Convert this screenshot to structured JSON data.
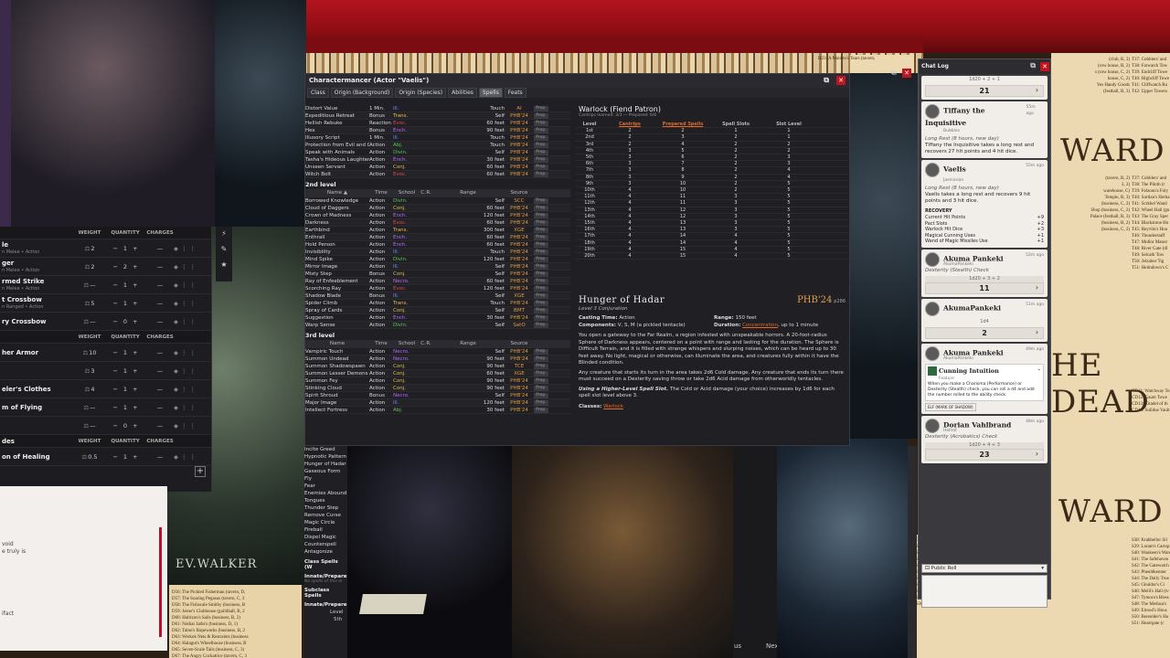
{
  "map": {
    "heading_ward_1": "WARD",
    "heading_dead": "HE DEAD",
    "heading_ward_2": "WARD",
    "right_list_top": [
      "T37: Cobblers' and",
      "T38: Farwatch Tow",
      "T39: Endcliff Towe",
      "T40: Highcliff Towe",
      "T41: Cliffwatch Ru",
      "T42: Upper Towers"
    ],
    "right_list_mid": [
      "T37: Cobblers' and",
      "T38: The Plinth (r",
      "T39: Felzoun's Foly",
      "T40: Surtlan's Herbal",
      "T41: Scrkhel Wand",
      "T42: Wheel Hall (gu",
      "T43: The Gray Sper",
      "T44: Blackstone Ho",
      "T45: Reyvlin's Hou",
      "T46: Thunderstaff",
      "T47: Mullor Manor",
      "T48: River Gate (dl",
      "T49: Selcath Tow",
      "T50: Jelzabor Tig",
      "T51: Helmdown's C"
    ],
    "right_list_mid_left": [
      "(tavern, B, 2)",
      "3, 2)",
      "warehouse, C)",
      "Temple, B, 3)",
      "(business, C, 2)",
      "Shop (business, C, 2)",
      "Palace (festhall, B, 3)",
      "(business, B, 2)",
      "(business, C, 2)"
    ],
    "right_list_low": [
      "CD11: Watchway To",
      "CD12: Gaunt Towe",
      "CD13: Citadel of th",
      "CD14: Sulldue Vault"
    ],
    "right_list_bottom": [
      "S38: Krabbellor Sil",
      "S39: Luram's Cartop",
      "S40: Waukeen's Ware",
      "S41: The Safehaven",
      "S42: The Gatewatch",
      "S43: Pheuldkenner",
      "S44: The Daily True",
      "S45: Ghuldor's Ci",
      "S46: Melil's Hall (tv",
      "S47: Tymora's Bless",
      "S48: The Medusa's",
      "S49: Elrood's Hous",
      "S50: Berenlder's Ha",
      "S51: Hoarrgate (c"
    ],
    "bottom_center_list": [
      "Inn (tavern, B, 3)",
      "S27: Wheelwright's (business, B, 3)",
      "S28: Tobold's (inn house, B)",
      "S29: Gauntlet Hall (rooming house, B, 4)",
      "S30: Irnsolm's Hall (store, B)",
      "S31: Patrician's Curios (business, C)",
      "S32: Ashmit's Laundry (business, C, 1)",
      "S33: Rakhem Inggen's residence (row house, B, 3)",
      "S34: Helmgrarns's Tables (business, B, 3)",
      "S35: Twelve Tors (business, C)",
      "S36: Kelsh Wagonjewls (business, B, 2)"
    ],
    "bottom_mid_list": [
      "Mordan Garzh's Boarding House",
      "Heart's Cheers (festhall, C)"
    ],
    "bottom_left_list": [
      "D56: The Pickled Fisherman (tavern, D,",
      "D57: The Soaring Pegasus (tavern, C, 3",
      "D58: The Fishscale Smithy (business, B",
      "D59: Jester's Clubhouse (guildhall, B, 2",
      "D60: Halrizon's Sails (business, B, 2)",
      "D61: Nothar Jaths's (business, D, 1)",
      "D62: Talnu's Ropeworks (business, B, 2",
      "D63: Werkok Nets & Restraints (business",
      "D64: Halagut's Wheelhouse (business, B",
      "D65: Seven-Scale Tails (business, C, 3)",
      "D67: The Angry Cockatrice (tavern, C, 3"
    ],
    "chunk_h": "H23: A Maiden's Tears (tavern,",
    "chunk_h2": "H28: The Bad Tavern (tavern, B,",
    "chunk_h3": "H29: Wolfgard's (business, B, 2)",
    "chunk_h4": "H30: The Manor Retreat (tavern, C, 2)",
    "chunk_right_top": [
      "(club, B, 3)",
      "(row house, B, 2)",
      "s (row house, C, 2)",
      "house, C, 2)",
      "Yes Handy Goods",
      "(festhall, B, 3)"
    ],
    "ev_walker": "EV.WALKER",
    "bottom_tab_us": "us",
    "bottom_tab_nex": "Nex"
  },
  "inventory": {
    "headers": {
      "weight": "WEIGHT",
      "quantity": "QUANTITY",
      "charges": "CHARGES"
    },
    "items": [
      {
        "name": "le",
        "sub": "n Melee • Action",
        "weight": "2",
        "qty": "1",
        "charges": "—"
      },
      {
        "name": "ger",
        "sub": "n Melee • Action",
        "weight": "2",
        "qty": "2",
        "charges": "—"
      },
      {
        "name": "rmed Strike",
        "sub": "n Melee • Action",
        "weight": "—",
        "qty": "1",
        "charges": "—"
      },
      {
        "name": "t Crossbow",
        "sub": "n Ranged • Action",
        "weight": "5",
        "qty": "1",
        "charges": "—"
      },
      {
        "name": "ry Crossbow",
        "sub": "",
        "weight": "—",
        "qty": "0",
        "charges": "—"
      }
    ],
    "armor_headers": {
      "weight": "WEIGHT",
      "quantity": "QUANTITY",
      "charges": "CHARGES"
    },
    "armor_items": [
      {
        "name": "her Armor",
        "sub": "",
        "weight": "10",
        "qty": "1",
        "charges": "—"
      },
      {
        "name": "",
        "sub": "",
        "weight": "3",
        "qty": "1",
        "charges": "—"
      },
      {
        "name": "eler's Clothes",
        "sub": "",
        "weight": "4",
        "qty": "1",
        "charges": "—"
      },
      {
        "name": "m of Flying",
        "sub": "",
        "weight": "—",
        "qty": "1",
        "charges": "—"
      },
      {
        "name": "",
        "sub": "",
        "weight": "—",
        "qty": "0",
        "charges": "—"
      }
    ],
    "consumables_label": "des",
    "consumables_headers": {
      "weight": "WEIGHT",
      "quantity": "QUANTITY",
      "charges": "CHARGES"
    },
    "consumables_items": [
      {
        "name": "on of Healing",
        "sub": "",
        "weight": "0.5",
        "qty": "1",
        "charges": "—"
      }
    ]
  },
  "notes": {
    "lines": [
      "void",
      "e truly is",
      "ifact"
    ]
  },
  "charactermancer": {
    "title": "Charactermancer (Actor \"Vaelis\")",
    "tabs": [
      "Class",
      "Origin (Background)",
      "Origin (Species)",
      "Abilities",
      "Spells",
      "Feats"
    ],
    "level1_rows": [
      [
        "Distort Value",
        "1 Min.",
        "Ill.",
        "Touch",
        "AI"
      ],
      [
        "Expeditious Retreat",
        "Bonus",
        "Trans.",
        "Self",
        "PHB'24"
      ],
      [
        "Hellish Rebuke",
        "Reaction",
        "Evoc.",
        "60 feet",
        "PHB'24"
      ],
      [
        "Hex",
        "Bonus",
        "Ench.",
        "90 feet",
        "PHB'24"
      ],
      [
        "Illusory Script",
        "1 Min.",
        "Ill.",
        "Touch",
        "PHB'24"
      ],
      [
        "Protection from Evil and Good",
        "Action",
        "Abj.",
        "Touch",
        "PHB'24"
      ],
      [
        "Speak with Animals",
        "Action",
        "Divin.",
        "Self",
        "PHB'24"
      ],
      [
        "Tasha's Hideous Laughter",
        "Action",
        "Ench.",
        "30 feet",
        "PHB'24"
      ],
      [
        "Unseen Servant",
        "Action",
        "Conj.",
        "60 feet",
        "PHB'24"
      ],
      [
        "Witch Bolt",
        "Action",
        "Evoc.",
        "60 feet",
        "PHB'24"
      ]
    ],
    "level2_label": "2nd level",
    "col_headers": [
      "Name ▲",
      "Time",
      "School",
      "C.",
      "R.",
      "Range",
      "Source"
    ],
    "level2_rows": [
      [
        "Borrowed Knowledge",
        "Action",
        "Divin.",
        "Self",
        "SCC"
      ],
      [
        "Cloud of Daggers",
        "Action",
        "Conj.",
        "60 feet",
        "PHB'24"
      ],
      [
        "Crown of Madness",
        "Action",
        "Ench.",
        "120 feet",
        "PHB'24"
      ],
      [
        "Darkness",
        "Action",
        "Evoc.",
        "60 feet",
        "PHB'24"
      ],
      [
        "Earthbind",
        "Action",
        "Trans.",
        "300 feet",
        "XGE"
      ],
      [
        "Enthrall",
        "Action",
        "Ench.",
        "60 feet",
        "PHB'24"
      ],
      [
        "Hold Person",
        "Action",
        "Ench.",
        "60 feet",
        "PHB'24"
      ],
      [
        "Invisibility",
        "Action",
        "Ill.",
        "Touch",
        "PHB'24"
      ],
      [
        "Mind Spike",
        "Action",
        "Divin.",
        "120 feet",
        "PHB'24"
      ],
      [
        "Mirror Image",
        "Action",
        "Ill.",
        "Self",
        "PHB'24"
      ],
      [
        "Misty Step",
        "Bonus",
        "Conj.",
        "Self",
        "PHB'24"
      ],
      [
        "Ray of Enfeeblement",
        "Action",
        "Necro.",
        "60 feet",
        "PHB'24"
      ],
      [
        "Scorching Ray",
        "Action",
        "Evoc.",
        "120 feet",
        "PHB'24"
      ],
      [
        "Shadow Blade",
        "Bonus",
        "Ill.",
        "Self",
        "XGE"
      ],
      [
        "Spider Climb",
        "Action",
        "Trans.",
        "Touch",
        "PHB'24"
      ],
      [
        "Spray of Cards",
        "Action",
        "Conj.",
        "Self",
        "BMT"
      ],
      [
        "Suggestion",
        "Action",
        "Ench.",
        "30 feet",
        "PHB'24"
      ],
      [
        "Warp Sense",
        "Action",
        "Divin.",
        "Self",
        "SatO"
      ]
    ],
    "level3_label": "3rd level",
    "col_headers3": [
      "Name",
      "Time",
      "School",
      "C.",
      "R.",
      "Range",
      "Source"
    ],
    "level3_rows": [
      [
        "Vampiric Touch",
        "Action",
        "Necro.",
        "Self",
        "PHB'24"
      ],
      [
        "Summon Undead",
        "Action",
        "Necro.",
        "90 feet",
        "PHB'24"
      ],
      [
        "Summon Shadowspawn",
        "Action",
        "Conj.",
        "90 feet",
        "TCE"
      ],
      [
        "Summon Lesser Demons",
        "Action",
        "Conj.",
        "60 feet",
        "XGE"
      ],
      [
        "Summon Fey",
        "Action",
        "Conj.",
        "90 feet",
        "PHB'24"
      ],
      [
        "Stinking Cloud",
        "Action",
        "Conj.",
        "90 feet",
        "PHB'24"
      ],
      [
        "Spirit Shroud",
        "Bonus",
        "Necro.",
        "Self",
        "PHB'24"
      ],
      [
        "Major Image",
        "Action",
        "Ill.",
        "120 feet",
        "PHB'24"
      ],
      [
        "Intellect Fortress",
        "Action",
        "Abj.",
        "30 feet",
        "PHB'24"
      ]
    ],
    "more_spells": [
      "Incite Greed",
      "Hypnotic Pattern",
      "Hunger of Hadar",
      "Gaseous Form",
      "Fly",
      "Fear",
      "Enemies Abound",
      "Tongues",
      "Thunder Step",
      "Remove Curse",
      "Magic Circle",
      "Fireball",
      "Dispel Magic",
      "Counterspell",
      "Antagonize"
    ],
    "class_spells_label": "Class Spells (W",
    "innate1": "Innate/Prepare",
    "no_spells": "No spells of this le",
    "subclass_spells": "Subclass Spells",
    "innate2": "Innate/Prepare",
    "level_label": "Level",
    "fifth": "5th"
  },
  "warlock_table": {
    "title": "Warlock (Fiend Patron)",
    "subtitle": "Cantrips learned: 3/3 — Prepared: 6/6",
    "headers": [
      "Level",
      "Cantrips",
      "Prepared Spells",
      "Spell Slots",
      "Slot Level"
    ],
    "rows": [
      [
        "1st",
        "2",
        "2",
        "1",
        "1"
      ],
      [
        "2nd",
        "2",
        "3",
        "2",
        "1"
      ],
      [
        "3rd",
        "2",
        "4",
        "2",
        "2"
      ],
      [
        "4th",
        "3",
        "5",
        "2",
        "2"
      ],
      [
        "5th",
        "3",
        "6",
        "2",
        "3"
      ],
      [
        "6th",
        "3",
        "7",
        "2",
        "3"
      ],
      [
        "7th",
        "3",
        "8",
        "2",
        "4"
      ],
      [
        "8th",
        "3",
        "9",
        "2",
        "4"
      ],
      [
        "9th",
        "3",
        "10",
        "2",
        "5"
      ],
      [
        "10th",
        "4",
        "10",
        "2",
        "5"
      ],
      [
        "11th",
        "4",
        "11",
        "3",
        "5"
      ],
      [
        "12th",
        "4",
        "11",
        "3",
        "5"
      ],
      [
        "13th",
        "4",
        "12",
        "3",
        "5"
      ],
      [
        "14th",
        "4",
        "12",
        "3",
        "5"
      ],
      [
        "15th",
        "4",
        "13",
        "3",
        "5"
      ],
      [
        "16th",
        "4",
        "13",
        "3",
        "5"
      ],
      [
        "17th",
        "4",
        "14",
        "4",
        "5"
      ],
      [
        "18th",
        "4",
        "14",
        "4",
        "5"
      ],
      [
        "19th",
        "4",
        "15",
        "4",
        "5"
      ],
      [
        "20th",
        "4",
        "15",
        "4",
        "5"
      ]
    ]
  },
  "spell": {
    "name": "Hunger of Hadar",
    "source": "PHB'24",
    "page": "p286",
    "level_school": "Level 3 Conjuration",
    "casting_time_label": "Casting Time:",
    "casting_time": "Action",
    "range_label": "Range:",
    "range": "150 feet",
    "components_label": "Components:",
    "components": "V, S, M (a pickled tentacle)",
    "duration_label": "Duration:",
    "duration_link": "Concentration",
    "duration_rest": ", up to 1 minute",
    "p1": "You open a gateway to the Far Realm, a region infested with unspeakable horrors. A 20-foot-radius Sphere of Darkness appears, centered on a point with range and lasting for the duration. The Sphere is Difficult Terrain, and it is filled with strange whispers and slurping noises, which can be heard up to 30 feet away. No light, magical or otherwise, can illuminate the area, and creatures fully within it have the Blinded condition.",
    "p2": "Any creature that starts its turn in the area takes 2d6 Cold damage. Any creature that ends its turn there must succeed on a Dexterity saving throw or take 2d6 Acid damage from otherworldly tentacles.",
    "higher_label": "Using a Higher-Level Spell Slot.",
    "higher": " The Cold or Acid damage (your choice) increases by 1d6 for each spell slot level above 3.",
    "classes_label": "Classes:",
    "classes": "Warlock"
  },
  "chat": {
    "title": "Chat Log",
    "top_roll_formula": "1d20 + 2 + 1",
    "top_roll_total": "21",
    "messages": [
      {
        "who": "Tiffany the Inquisitive",
        "sub": "Bubbles",
        "time": "55m ago",
        "title": "Long Rest (8 hours, new day)",
        "body": "Tiffany the Inquisitive takes a long rest and recovers 27 hit points and 4 hit dice."
      },
      {
        "who": "Vaelis",
        "sub": "Jasmarian",
        "time": "55m ago",
        "title": "Long Rest (8 hours, new day)",
        "body": "Vaelis takes a long rest and recovers 9 hit points and 3 hit dice."
      }
    ],
    "recovery_label": "RECOVERY",
    "recovery": [
      {
        "label": "Current Hit Points",
        "value": "+9"
      },
      {
        "label": "Pact Slots",
        "value": "+2"
      },
      {
        "label": "Warlock Hit Dice",
        "value": "+3"
      },
      {
        "label": "Magical Cunning Uses",
        "value": "+1"
      },
      {
        "label": "Wand of Magic Missiles Use",
        "value": "+1"
      }
    ],
    "roll1": {
      "who": "Akuma Pankeki",
      "sub": "AkumaPankeki",
      "time": "52m ago",
      "check": "Dexterity (Stealth) Check",
      "formula": "1d20 + 3 + 2",
      "total": "11"
    },
    "roll2": {
      "who": "AkumaPankeki",
      "time": "51m ago",
      "formula": "1d4",
      "total": "2"
    },
    "roll3": {
      "who": "Akuma Pankeki",
      "sub": "AkumaPankeki",
      "time": "49m ago",
      "feature": "Cunning Intuition",
      "feature_sub": "Feature",
      "feature_text": "When you make a Charisma (Performance) or Dexterity (Stealth) check, you can roll a d4 and add the number rolled to the ability check.",
      "tag": "ELF (MARK OF SHADOW)"
    },
    "roll4": {
      "who": "Dorian Vahlbrand",
      "sub": "Hellrot",
      "time": "48m ago",
      "check": "Dexterity (Acrobatics) Check",
      "formula": "1d20 + 4 + 3",
      "total": "23"
    },
    "roll_mode": "Public Roll"
  },
  "colors": {
    "accent_red": "#c0151f",
    "link_orange": "#e36a2a",
    "chat_bg": "#f1eee9"
  }
}
